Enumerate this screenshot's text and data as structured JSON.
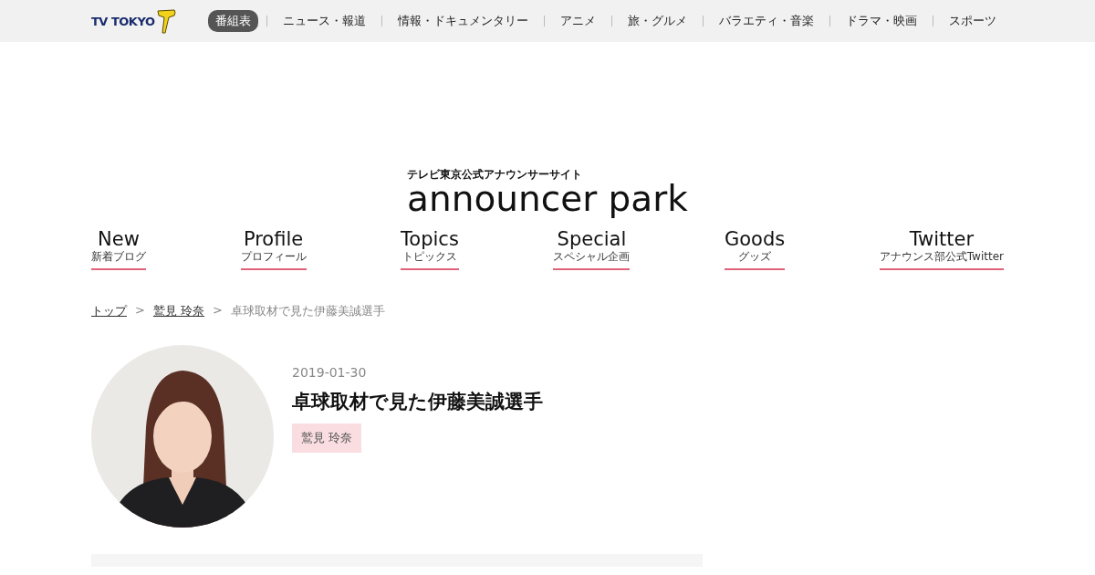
{
  "header": {
    "logo": "TV TOKYO",
    "menu": [
      {
        "label": "番組表",
        "selected": true
      },
      {
        "label": "ニュース・報道",
        "selected": false
      },
      {
        "label": "情報・ドキュメンタリー",
        "selected": false
      },
      {
        "label": "アニメ",
        "selected": false
      },
      {
        "label": "旅・グルメ",
        "selected": false
      },
      {
        "label": "バラエティ・音楽",
        "selected": false
      },
      {
        "label": "ドラマ・映画",
        "selected": false
      },
      {
        "label": "スポーツ",
        "selected": false
      }
    ]
  },
  "site_logo": {
    "tagline": "テレビ東京公式アナウンサーサイト",
    "name": "announcer park"
  },
  "nav": [
    {
      "label": "New",
      "sublabel": "新着ブログ"
    },
    {
      "label": "Profile",
      "sublabel": "プロフィール"
    },
    {
      "label": "Topics",
      "sublabel": "トピックス"
    },
    {
      "label": "Special",
      "sublabel": "スペシャル企画"
    },
    {
      "label": "Goods",
      "sublabel": "グッズ"
    },
    {
      "label": "Twitter",
      "sublabel": "アナウンス部公式Twitter"
    }
  ],
  "breadcrumb": [
    {
      "label": "トップ",
      "kind": "link"
    },
    {
      "label": ">",
      "kind": "separator"
    },
    {
      "label": "鷲見 玲奈",
      "kind": "link"
    },
    {
      "label": ">",
      "kind": "separator"
    },
    {
      "label": "卓球取材で見た伊藤美誠選手",
      "kind": "current"
    }
  ],
  "article": {
    "date": "2019-01-30",
    "title": "卓球取材で見た伊藤美誠選手",
    "tag": "鷲見 玲奈"
  }
}
